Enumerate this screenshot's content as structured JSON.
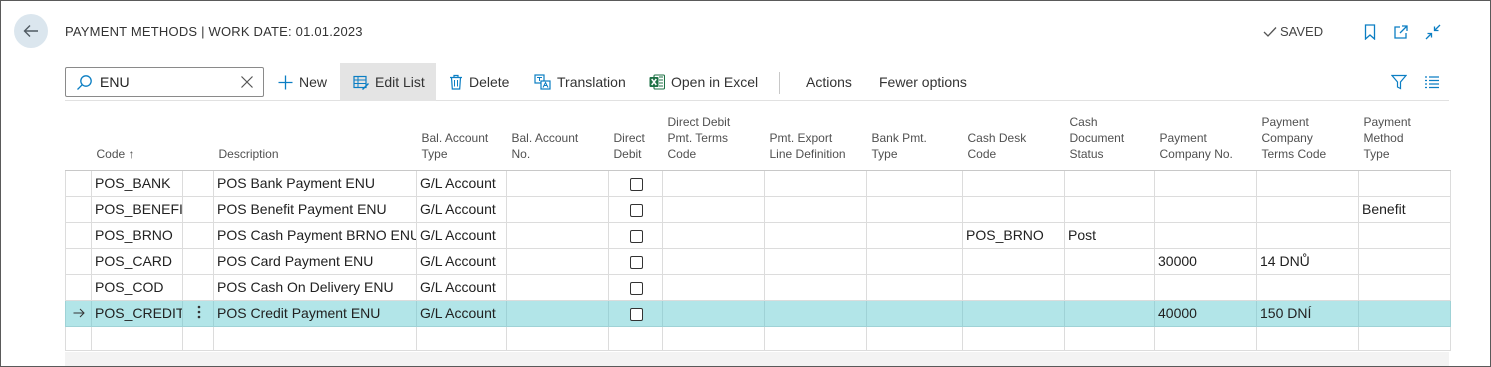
{
  "header": {
    "title": "PAYMENT METHODS | WORK DATE: 01.01.2023",
    "saved_label": "SAVED"
  },
  "search": {
    "value": "ENU",
    "placeholder": "Search"
  },
  "actions": {
    "new_label": "New",
    "edit_list_label": "Edit List",
    "delete_label": "Delete",
    "translation_label": "Translation",
    "open_excel_label": "Open in Excel",
    "actions_label": "Actions",
    "fewer_options_label": "Fewer options"
  },
  "columns": {
    "code": "Code ↑",
    "description": "Description",
    "bal_account_type": [
      "Bal. Account",
      "Type"
    ],
    "bal_account_no": [
      "Bal. Account",
      "No."
    ],
    "direct_debit": [
      "Direct",
      "Debit"
    ],
    "direct_debit_terms": [
      "Direct Debit",
      "Pmt. Terms",
      "Code"
    ],
    "pmt_export": [
      "Pmt. Export",
      "Line Definition"
    ],
    "bank_pmt_type": [
      "Bank Pmt.",
      "Type"
    ],
    "cash_desk_code": [
      "Cash Desk",
      "Code"
    ],
    "cash_doc_status": [
      "Cash",
      "Document",
      "Status"
    ],
    "payment_company_no": [
      "Payment",
      "Company No."
    ],
    "payment_company_terms": [
      "Payment",
      "Company",
      "Terms Code"
    ],
    "payment_method_type": [
      "Payment",
      "Method",
      "Type"
    ]
  },
  "rows": [
    {
      "code": "POS_BANK",
      "description": "POS Bank Payment ENU",
      "bal_type": "G/L Account",
      "cash_desk": "",
      "cash_status": "",
      "company_no": "",
      "company_terms": "",
      "method_type": "",
      "direct_debit": false,
      "selected": false
    },
    {
      "code": "POS_BENEFI",
      "description": "POS Benefit Payment ENU",
      "bal_type": "G/L Account",
      "cash_desk": "",
      "cash_status": "",
      "company_no": "",
      "company_terms": "",
      "method_type": "Benefit",
      "direct_debit": false,
      "selected": false
    },
    {
      "code": "POS_BRNO",
      "description": "POS Cash Payment BRNO ENU",
      "bal_type": "G/L Account",
      "cash_desk": "POS_BRNO",
      "cash_status": "Post",
      "company_no": "",
      "company_terms": "",
      "method_type": "",
      "direct_debit": false,
      "selected": false
    },
    {
      "code": "POS_CARD",
      "description": "POS Card Payment ENU",
      "bal_type": "G/L Account",
      "cash_desk": "",
      "cash_status": "",
      "company_no": "30000",
      "company_terms": "14 DNŮ",
      "method_type": "",
      "direct_debit": false,
      "selected": false
    },
    {
      "code": "POS_COD",
      "description": "POS Cash On Delivery ENU",
      "bal_type": "G/L Account",
      "cash_desk": "",
      "cash_status": "",
      "company_no": "",
      "company_terms": "",
      "method_type": "",
      "direct_debit": false,
      "selected": false
    },
    {
      "code": "POS_CREDIT",
      "description": "POS Credit Payment ENU",
      "bal_type": "G/L Account",
      "cash_desk": "",
      "cash_status": "",
      "company_no": "40000",
      "company_terms": "150 DNÍ",
      "method_type": "",
      "direct_debit": false,
      "selected": true
    }
  ],
  "colors": {
    "selected_row": "#b2e5e8",
    "back_button": "#dbe6ee",
    "accent": "#0b7ec3",
    "excel_green": "#1e7145"
  },
  "icons": {
    "back": "arrow-left-icon",
    "saved": "checkmark-icon",
    "bookmark": "bookmark-icon",
    "open_new_window": "open-new-window-icon",
    "collapse": "collapse-icon",
    "search": "search-icon",
    "clear": "close-icon",
    "new": "plus-icon",
    "edit_list": "edit-list-icon",
    "delete": "trash-icon",
    "translation": "translation-icon",
    "excel": "excel-icon",
    "filter": "filter-icon",
    "list_view": "list-view-icon",
    "row_menu": "more-vertical-icon",
    "current_row": "arrow-right-icon"
  }
}
